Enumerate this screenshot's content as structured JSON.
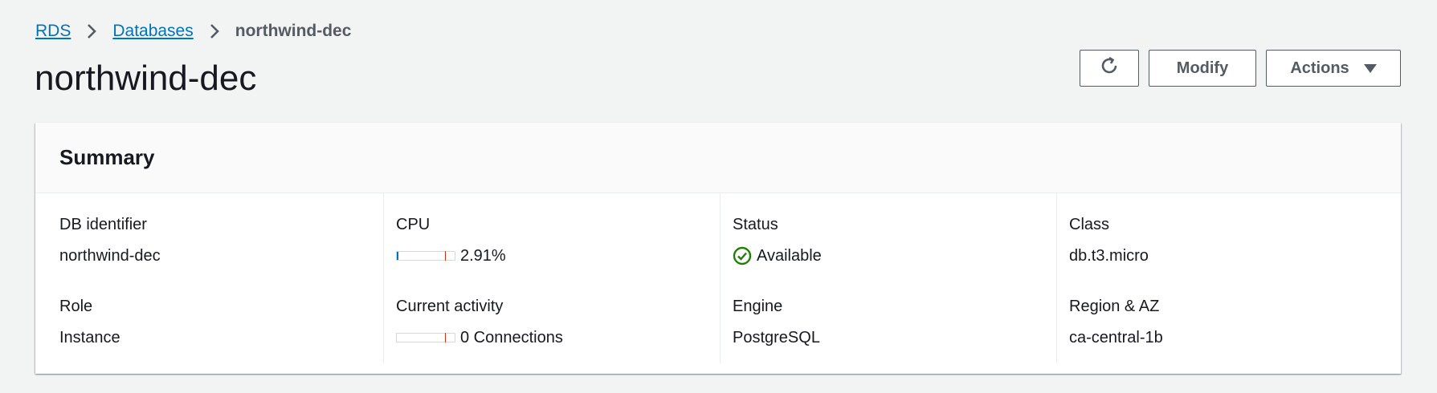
{
  "breadcrumb": {
    "items": [
      "RDS",
      "Databases"
    ],
    "current": "northwind-dec"
  },
  "page": {
    "title": "northwind-dec"
  },
  "toolbar": {
    "modify_label": "Modify",
    "actions_label": "Actions"
  },
  "summary": {
    "title": "Summary",
    "db_identifier": {
      "label": "DB identifier",
      "value": "northwind-dec"
    },
    "role": {
      "label": "Role",
      "value": "Instance"
    },
    "cpu": {
      "label": "CPU",
      "value": "2.91%",
      "fraction": 0.0291
    },
    "current_activity": {
      "label": "Current activity",
      "value": "0 Connections",
      "fraction": 0
    },
    "status": {
      "label": "Status",
      "value": "Available",
      "color": "#1d8102"
    },
    "engine": {
      "label": "Engine",
      "value": "PostgreSQL"
    },
    "class": {
      "label": "Class",
      "value": "db.t3.micro"
    },
    "region_az": {
      "label": "Region & AZ",
      "value": "ca-central-1b"
    }
  },
  "icons": {
    "refresh": "refresh-icon",
    "separator": "chevron-right-icon",
    "status": "check-circle-icon",
    "actions_dropdown": "caret-down-icon"
  },
  "colors": {
    "link": "#0073bb",
    "success": "#1d8102",
    "meter_threshold": "#d13212",
    "background": "#f2f3f3"
  }
}
